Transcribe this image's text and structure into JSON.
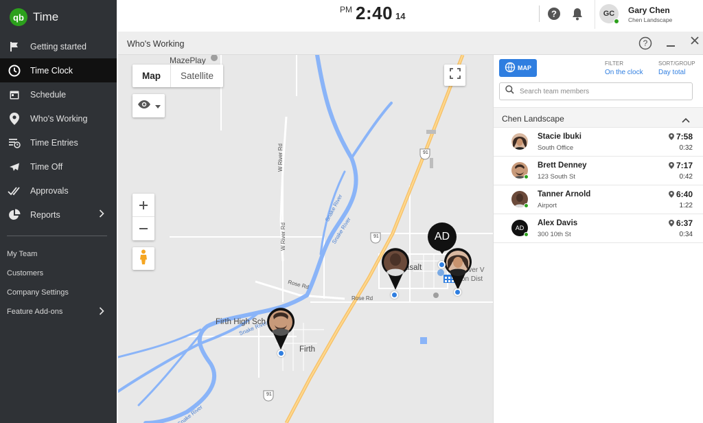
{
  "app": {
    "name": "Time",
    "logo_text": "qb"
  },
  "sidebar": {
    "items": [
      {
        "label": "Getting started",
        "icon": "flag-icon"
      },
      {
        "label": "Time Clock",
        "icon": "clock-icon",
        "active": true
      },
      {
        "label": "Schedule",
        "icon": "calendar-icon"
      },
      {
        "label": "Who's Working",
        "icon": "location-pin-icon"
      },
      {
        "label": "Time Entries",
        "icon": "time-entries-icon"
      },
      {
        "label": "Time Off",
        "icon": "airplane-icon"
      },
      {
        "label": "Approvals",
        "icon": "double-check-icon"
      },
      {
        "label": "Reports",
        "icon": "pie-chart-icon",
        "has_submenu": true
      }
    ],
    "secondary": [
      {
        "label": "My Team"
      },
      {
        "label": "Customers"
      },
      {
        "label": "Company Settings"
      },
      {
        "label": "Feature Add-ons",
        "has_submenu": true
      }
    ]
  },
  "topbar": {
    "clock": {
      "ampm": "PM",
      "time": "2:40",
      "seconds": "14"
    },
    "user": {
      "initials": "GC",
      "name": "Gary Chen",
      "company": "Chen Landscape"
    }
  },
  "window": {
    "title": "Who's Working",
    "map": {
      "type_options": [
        "Map",
        "Satellite"
      ],
      "selected_type": "Map",
      "labels": {
        "mazeplay": "MazePlay",
        "w_river_rd_1": "W River Rd",
        "w_river_rd_2": "W River Rd",
        "snake_river_1": "Snake River",
        "snake_river_2": "Snake River",
        "snake_river_3": "Snake River",
        "snake_river_4": "Snake River",
        "rose_rd_1": "Rose Rd",
        "rose_rd_2": "Rose Rd",
        "firth": "Firth",
        "firth_high": "Firth High Sch",
        "basalt": "asalt",
        "river_v": "iver V",
        "district": "on Dist",
        "route_91_a": "91",
        "route_91_b": "91",
        "route_91_c": "91"
      },
      "pins": {
        "alex_initials": "AD"
      }
    },
    "panel": {
      "map_button": "MAP",
      "filter_label": "FILTER",
      "filter_value": "On the clock",
      "sort_label": "SORT/GROUP",
      "sort_value": "Day total",
      "search_placeholder": "Search team members",
      "group_name": "Chen Landscape",
      "members": [
        {
          "name": "Stacie Ibuki",
          "location": "South Office",
          "clock_in": "7:58",
          "duration": "0:32"
        },
        {
          "name": "Brett Denney",
          "location": "123 South St",
          "clock_in": "7:17",
          "duration": "0:42"
        },
        {
          "name": "Tanner Arnold",
          "location": "Airport",
          "clock_in": "6:40",
          "duration": "1:22"
        },
        {
          "name": "Alex Davis",
          "location": "300 10th St",
          "clock_in": "6:37",
          "duration": "0:34",
          "initials": "AD"
        }
      ]
    }
  },
  "colors": {
    "sidebar_bg": "#2f3236",
    "active_bg": "#111111",
    "brand_green": "#2ca01c",
    "accent_blue": "#2f7ee0",
    "river_blue": "#8ab4f8",
    "highway": "#f6c26b"
  }
}
